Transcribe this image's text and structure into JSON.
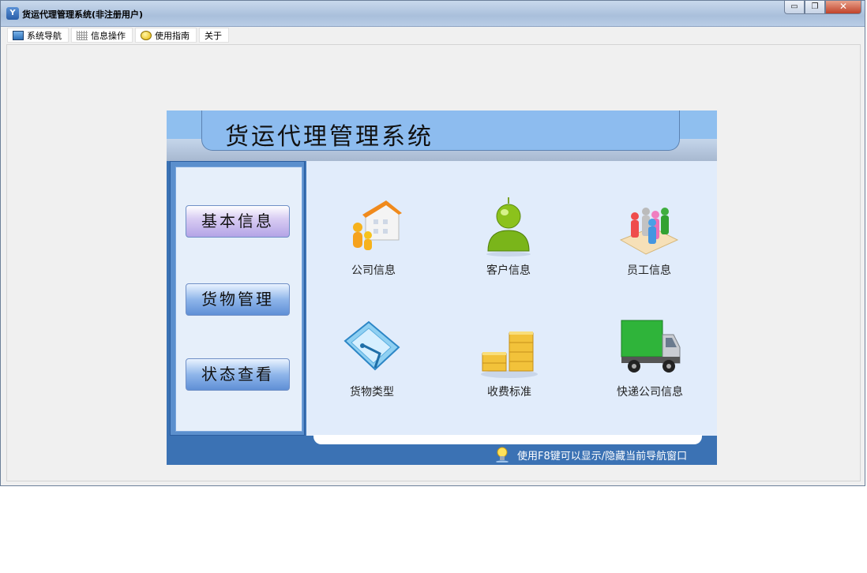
{
  "window": {
    "title": "货运代理管理系统(非注册用户)",
    "icon_label": "Y",
    "controls": {
      "minimize": "▭",
      "restore": "❐",
      "close": "✕"
    }
  },
  "tabs": [
    {
      "label": "系统导航",
      "icon": "monitor-icon"
    },
    {
      "label": "信息操作",
      "icon": "grid-icon"
    },
    {
      "label": "使用指南",
      "icon": "smiley-icon"
    },
    {
      "label": "关于",
      "icon": ""
    }
  ],
  "panel": {
    "title": "货运代理管理系统",
    "nav": [
      "基本信息",
      "货物管理",
      "状态查看"
    ],
    "items": [
      {
        "label": "公司信息",
        "icon": "company-building-icon"
      },
      {
        "label": "客户信息",
        "icon": "customer-person-icon"
      },
      {
        "label": "员工信息",
        "icon": "staff-group-icon"
      },
      {
        "label": "货物类型",
        "icon": "goods-type-icon"
      },
      {
        "label": "收费标准",
        "icon": "gold-coins-icon"
      },
      {
        "label": "快递公司信息",
        "icon": "delivery-truck-icon"
      }
    ],
    "hint": "使用F8键可以显示/隐藏当前导航窗口"
  },
  "colors": {
    "banner": "#8fbfef",
    "panel_border": "#3b72b4",
    "content_bg": "#e1ecfb"
  }
}
